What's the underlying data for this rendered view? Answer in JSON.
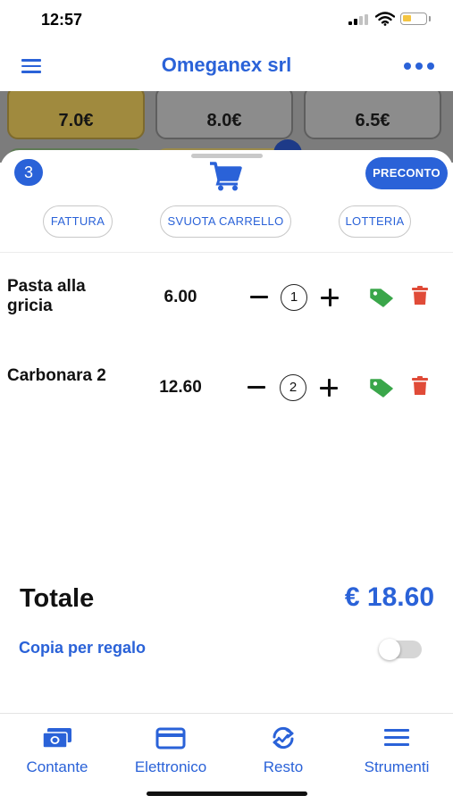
{
  "status_bar": {
    "time": "12:57"
  },
  "header": {
    "title": "Omeganex srl"
  },
  "background_tiles": {
    "prices": [
      "7.0€",
      "8.0€",
      "6.5€"
    ]
  },
  "cart": {
    "count": "3",
    "preconto_label": "PRECONTO",
    "actions": [
      "FATTURA",
      "SVUOTA CARRELLO",
      "LOTTERIA"
    ],
    "items": [
      {
        "name": "Pasta alla gricia",
        "price": "6.00",
        "qty": "1"
      },
      {
        "name": "Carbonara 2",
        "price": "12.60",
        "qty": "2"
      }
    ],
    "total_label": "Totale",
    "total_value": "€ 18.60",
    "gift_label": "Copia per regalo",
    "gift_toggle_on": false
  },
  "tabs": [
    {
      "label": "Contante",
      "icon": "cash-icon"
    },
    {
      "label": "Elettronico",
      "icon": "credit-card-icon"
    },
    {
      "label": "Resto",
      "icon": "change-cycle-icon"
    },
    {
      "label": "Strumenti",
      "icon": "menu-lines-icon"
    }
  ],
  "colors": {
    "accent": "#2a62d8",
    "tag": "#3aa64a",
    "trash": "#e04b38"
  }
}
